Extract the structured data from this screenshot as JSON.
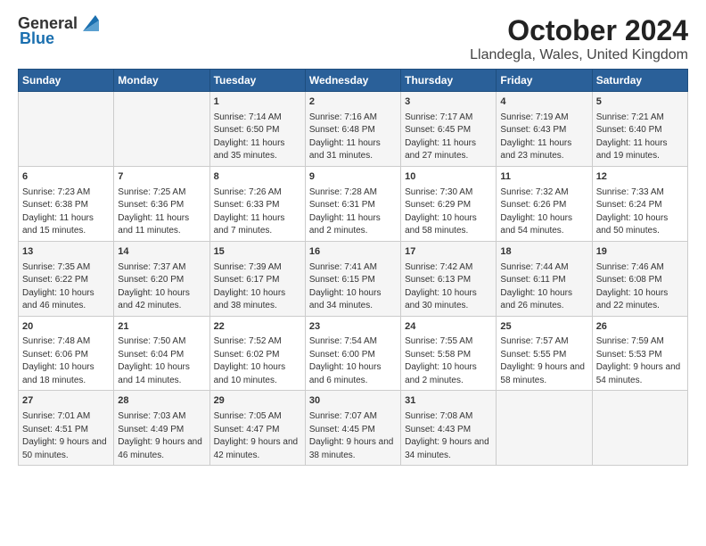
{
  "header": {
    "logo_general": "General",
    "logo_blue": "Blue",
    "title": "October 2024",
    "subtitle": "Llandegla, Wales, United Kingdom"
  },
  "weekdays": [
    "Sunday",
    "Monday",
    "Tuesday",
    "Wednesday",
    "Thursday",
    "Friday",
    "Saturday"
  ],
  "weeks": [
    [
      {
        "day": "",
        "info": ""
      },
      {
        "day": "",
        "info": ""
      },
      {
        "day": "1",
        "info": "Sunrise: 7:14 AM\nSunset: 6:50 PM\nDaylight: 11 hours and 35 minutes."
      },
      {
        "day": "2",
        "info": "Sunrise: 7:16 AM\nSunset: 6:48 PM\nDaylight: 11 hours and 31 minutes."
      },
      {
        "day": "3",
        "info": "Sunrise: 7:17 AM\nSunset: 6:45 PM\nDaylight: 11 hours and 27 minutes."
      },
      {
        "day": "4",
        "info": "Sunrise: 7:19 AM\nSunset: 6:43 PM\nDaylight: 11 hours and 23 minutes."
      },
      {
        "day": "5",
        "info": "Sunrise: 7:21 AM\nSunset: 6:40 PM\nDaylight: 11 hours and 19 minutes."
      }
    ],
    [
      {
        "day": "6",
        "info": "Sunrise: 7:23 AM\nSunset: 6:38 PM\nDaylight: 11 hours and 15 minutes."
      },
      {
        "day": "7",
        "info": "Sunrise: 7:25 AM\nSunset: 6:36 PM\nDaylight: 11 hours and 11 minutes."
      },
      {
        "day": "8",
        "info": "Sunrise: 7:26 AM\nSunset: 6:33 PM\nDaylight: 11 hours and 7 minutes."
      },
      {
        "day": "9",
        "info": "Sunrise: 7:28 AM\nSunset: 6:31 PM\nDaylight: 11 hours and 2 minutes."
      },
      {
        "day": "10",
        "info": "Sunrise: 7:30 AM\nSunset: 6:29 PM\nDaylight: 10 hours and 58 minutes."
      },
      {
        "day": "11",
        "info": "Sunrise: 7:32 AM\nSunset: 6:26 PM\nDaylight: 10 hours and 54 minutes."
      },
      {
        "day": "12",
        "info": "Sunrise: 7:33 AM\nSunset: 6:24 PM\nDaylight: 10 hours and 50 minutes."
      }
    ],
    [
      {
        "day": "13",
        "info": "Sunrise: 7:35 AM\nSunset: 6:22 PM\nDaylight: 10 hours and 46 minutes."
      },
      {
        "day": "14",
        "info": "Sunrise: 7:37 AM\nSunset: 6:20 PM\nDaylight: 10 hours and 42 minutes."
      },
      {
        "day": "15",
        "info": "Sunrise: 7:39 AM\nSunset: 6:17 PM\nDaylight: 10 hours and 38 minutes."
      },
      {
        "day": "16",
        "info": "Sunrise: 7:41 AM\nSunset: 6:15 PM\nDaylight: 10 hours and 34 minutes."
      },
      {
        "day": "17",
        "info": "Sunrise: 7:42 AM\nSunset: 6:13 PM\nDaylight: 10 hours and 30 minutes."
      },
      {
        "day": "18",
        "info": "Sunrise: 7:44 AM\nSunset: 6:11 PM\nDaylight: 10 hours and 26 minutes."
      },
      {
        "day": "19",
        "info": "Sunrise: 7:46 AM\nSunset: 6:08 PM\nDaylight: 10 hours and 22 minutes."
      }
    ],
    [
      {
        "day": "20",
        "info": "Sunrise: 7:48 AM\nSunset: 6:06 PM\nDaylight: 10 hours and 18 minutes."
      },
      {
        "day": "21",
        "info": "Sunrise: 7:50 AM\nSunset: 6:04 PM\nDaylight: 10 hours and 14 minutes."
      },
      {
        "day": "22",
        "info": "Sunrise: 7:52 AM\nSunset: 6:02 PM\nDaylight: 10 hours and 10 minutes."
      },
      {
        "day": "23",
        "info": "Sunrise: 7:54 AM\nSunset: 6:00 PM\nDaylight: 10 hours and 6 minutes."
      },
      {
        "day": "24",
        "info": "Sunrise: 7:55 AM\nSunset: 5:58 PM\nDaylight: 10 hours and 2 minutes."
      },
      {
        "day": "25",
        "info": "Sunrise: 7:57 AM\nSunset: 5:55 PM\nDaylight: 9 hours and 58 minutes."
      },
      {
        "day": "26",
        "info": "Sunrise: 7:59 AM\nSunset: 5:53 PM\nDaylight: 9 hours and 54 minutes."
      }
    ],
    [
      {
        "day": "27",
        "info": "Sunrise: 7:01 AM\nSunset: 4:51 PM\nDaylight: 9 hours and 50 minutes."
      },
      {
        "day": "28",
        "info": "Sunrise: 7:03 AM\nSunset: 4:49 PM\nDaylight: 9 hours and 46 minutes."
      },
      {
        "day": "29",
        "info": "Sunrise: 7:05 AM\nSunset: 4:47 PM\nDaylight: 9 hours and 42 minutes."
      },
      {
        "day": "30",
        "info": "Sunrise: 7:07 AM\nSunset: 4:45 PM\nDaylight: 9 hours and 38 minutes."
      },
      {
        "day": "31",
        "info": "Sunrise: 7:08 AM\nSunset: 4:43 PM\nDaylight: 9 hours and 34 minutes."
      },
      {
        "day": "",
        "info": ""
      },
      {
        "day": "",
        "info": ""
      }
    ]
  ]
}
